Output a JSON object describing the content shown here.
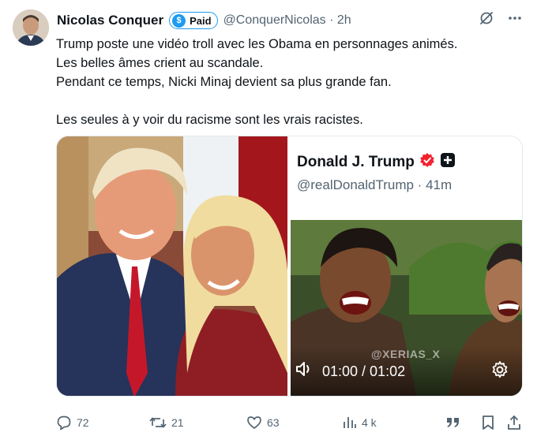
{
  "author": {
    "display_name": "Nicolas Conquer",
    "paid_label": "Paid",
    "paid_icon": "$",
    "handle": "@ConquerNicolas",
    "dot": "·",
    "time": "2h"
  },
  "tweet": {
    "lines": [
      "Trump poste une vidéo troll avec les Obama en personnages animés.",
      "Les belles âmes crient au scandale.",
      "Pendant ce temps, Nicki Minaj devient sa plus grande fan.",
      "Les seules à y voir du racisme sont les vrais racistes."
    ]
  },
  "embed": {
    "name": "Donald J. Trump",
    "handle": "@realDonaldTrump · 41m",
    "video_time": "01:00 / 01:02",
    "watermark": "@XERIAS_X"
  },
  "actions": {
    "replies": "72",
    "reposts": "21",
    "likes": "63",
    "views": "4 k"
  },
  "colors": {
    "accent": "#1d9bf0",
    "muted": "#536471",
    "text": "#0f1419"
  }
}
